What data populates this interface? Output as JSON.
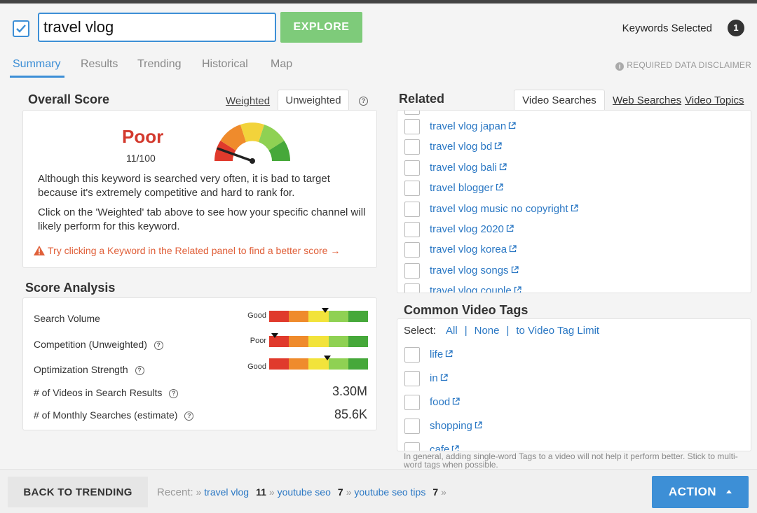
{
  "header": {
    "search_value": "travel vlog",
    "explore_label": "EXPLORE",
    "keywords_selected_label": "Keywords Selected",
    "keywords_selected_count": "1"
  },
  "tabs": [
    {
      "label": "Summary",
      "active": true
    },
    {
      "label": "Results"
    },
    {
      "label": "Trending"
    },
    {
      "label": "Historical"
    },
    {
      "label": "Map"
    }
  ],
  "disclaimer": "REQUIRED DATA DISCLAIMER",
  "overall": {
    "title": "Overall Score",
    "weighted_tab": "Weighted",
    "unweighted_tab": "Unweighted",
    "rating": "Poor",
    "score": "11/100",
    "gauge_value": 11,
    "para1": "Although this keyword is searched very often, it is bad to target because it's extremely competitive and hard to rank for.",
    "para2": "Click on the 'Weighted' tab above to see how your specific channel will likely perform for this keyword.",
    "warning": "Try clicking a Keyword in the Related panel to find a better score →"
  },
  "analysis": {
    "title": "Score Analysis",
    "rows": [
      {
        "label": "Search Volume",
        "rating": "Good",
        "level": 0.57
      },
      {
        "label": "Competition (Unweighted)",
        "rating": "Poor",
        "level": 0.06
      },
      {
        "label": "Optimization Strength",
        "rating": "Good",
        "level": 0.59
      }
    ],
    "stats": [
      {
        "label": "# of Videos in Search Results",
        "value": "3.30M"
      },
      {
        "label": "# of Monthly Searches (estimate)",
        "value": "85.6K"
      }
    ]
  },
  "related": {
    "title": "Related",
    "tabs": [
      "Video Searches",
      "Web Searches",
      "Video Topics"
    ],
    "items": [
      "travel vlog japan",
      "travel vlog bd",
      "travel vlog bali",
      "travel blogger",
      "travel vlog music no copyright",
      "travel vlog 2020",
      "travel vlog korea",
      "travel vlog songs",
      "travel vlog couple"
    ]
  },
  "tags": {
    "title": "Common Video Tags",
    "select_label": "Select:",
    "select_all": "All",
    "select_none": "None",
    "select_limit": "to Video Tag Limit",
    "items": [
      "life",
      "in",
      "food",
      "shopping",
      "cafe"
    ],
    "note": "In general, adding single-word Tags to a video will not help it perform better. Stick to multi-word tags when possible."
  },
  "footer": {
    "back_label": "BACK TO TRENDING",
    "recent_label": "Recent:",
    "recent": [
      {
        "term": "travel vlog",
        "count": "11"
      },
      {
        "term": "youtube seo",
        "count": "7"
      },
      {
        "term": "youtube seo tips",
        "count": "7"
      }
    ],
    "action_label": "ACTION"
  },
  "colors": {
    "accent": "#3d8fd6",
    "explore": "#7ecb7a",
    "poor": "#d33a2e",
    "link": "#2b78c4"
  }
}
